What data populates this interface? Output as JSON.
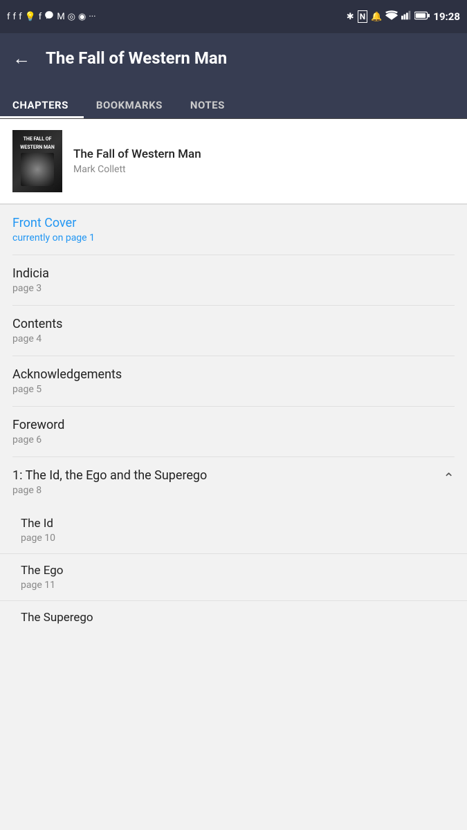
{
  "statusBar": {
    "time": "19:28",
    "icons": [
      "f",
      "f",
      "f",
      "💡",
      "f",
      "✉",
      "M",
      "◎",
      "◉",
      "···",
      "✱",
      "N",
      "🔔",
      "▼",
      "▲",
      "🔋"
    ]
  },
  "appBar": {
    "backLabel": "←",
    "title": "The Fall of Western Man"
  },
  "tabs": [
    {
      "label": "CHAPTERS",
      "active": true
    },
    {
      "label": "BOOKMARKS",
      "active": false
    },
    {
      "label": "NOTES",
      "active": false
    }
  ],
  "book": {
    "title": "The Fall of Western Man",
    "author": "Mark Collett",
    "coverTitleLine1": "THE FALL OF",
    "coverTitleLine2": "WESTERN MAN"
  },
  "chapters": [
    {
      "id": "front-cover",
      "name": "Front Cover",
      "page": "currently on page 1",
      "active": true,
      "expandable": false
    },
    {
      "id": "indicia",
      "name": "Indicia",
      "page": "page 3",
      "active": false,
      "expandable": false
    },
    {
      "id": "contents",
      "name": "Contents",
      "page": "page 4",
      "active": false,
      "expandable": false
    },
    {
      "id": "acknowledgements",
      "name": "Acknowledgements",
      "page": "page 5",
      "active": false,
      "expandable": false
    },
    {
      "id": "foreword",
      "name": "Foreword",
      "page": "page 6",
      "active": false,
      "expandable": false
    },
    {
      "id": "chapter-1",
      "name": "1: The Id, the Ego and the Superego",
      "page": "page 8",
      "active": false,
      "expandable": true,
      "expanded": true,
      "subChapters": [
        {
          "name": "The Id",
          "page": "page 10"
        },
        {
          "name": "The Ego",
          "page": "page 11"
        },
        {
          "name": "The Superego",
          "page": ""
        }
      ]
    }
  ]
}
